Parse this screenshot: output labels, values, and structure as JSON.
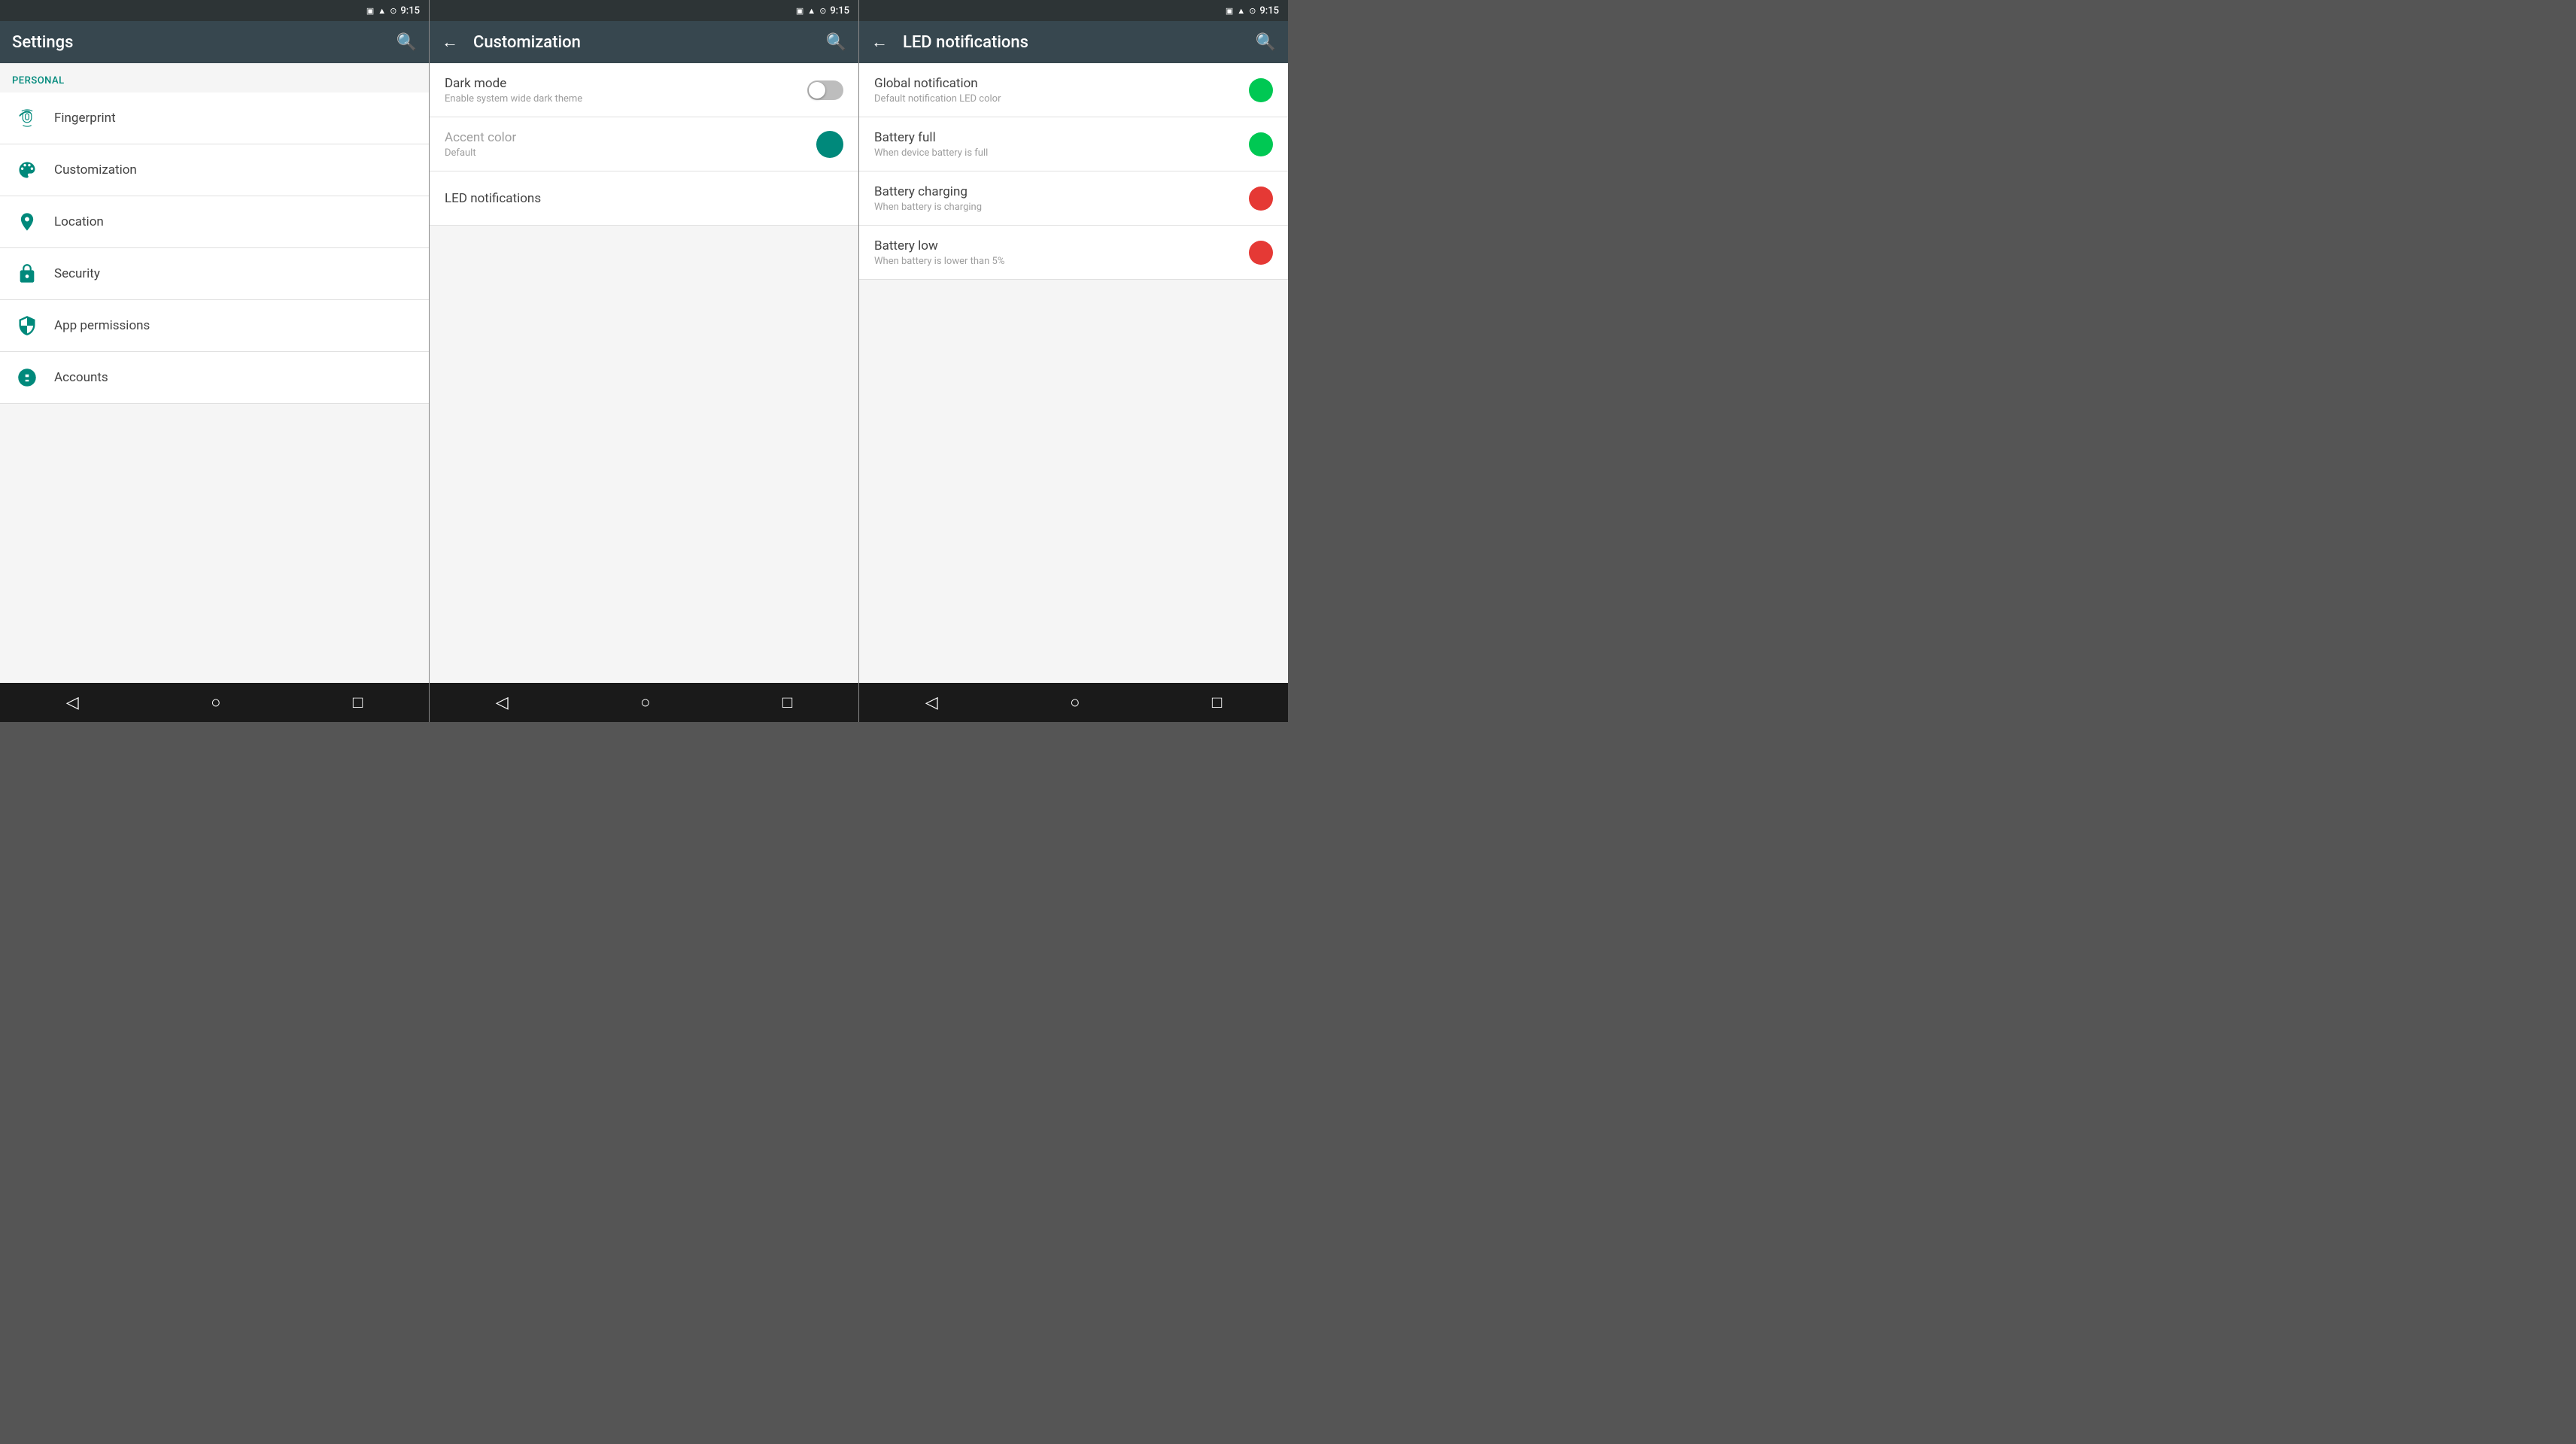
{
  "screens": [
    {
      "id": "settings",
      "statusBar": {
        "time": "9:15",
        "icons": [
          "vibrate",
          "signal",
          "battery"
        ]
      },
      "topBar": {
        "title": "Settings",
        "hasBack": false,
        "hasSearch": true
      },
      "sectionLabel": "Personal",
      "items": [
        {
          "id": "fingerprint",
          "label": "Fingerprint",
          "icon": "fingerprint"
        },
        {
          "id": "customization",
          "label": "Customization",
          "icon": "customization"
        },
        {
          "id": "location",
          "label": "Location",
          "icon": "location"
        },
        {
          "id": "security",
          "label": "Security",
          "icon": "security"
        },
        {
          "id": "app-permissions",
          "label": "App permissions",
          "icon": "shield"
        },
        {
          "id": "accounts",
          "label": "Accounts",
          "icon": "accounts"
        }
      ],
      "navBar": {
        "back": "◁",
        "home": "○",
        "recent": "□"
      }
    },
    {
      "id": "customization",
      "statusBar": {
        "time": "9:15"
      },
      "topBar": {
        "title": "Customization",
        "hasBack": true,
        "hasSearch": true
      },
      "settings": [
        {
          "id": "dark-mode",
          "title": "Dark mode",
          "subtitle": "Enable system wide dark theme",
          "type": "toggle",
          "enabled": false
        },
        {
          "id": "accent-color",
          "title": "Accent color",
          "subtitle": "Default",
          "type": "color",
          "color": "#00897b",
          "dimmed": true
        },
        {
          "id": "led-notifications",
          "title": "LED notifications",
          "type": "plain"
        }
      ],
      "navBar": {
        "back": "◁",
        "home": "○",
        "recent": "□"
      }
    },
    {
      "id": "led",
      "statusBar": {
        "time": "9:15"
      },
      "topBar": {
        "title": "LED notifications",
        "hasBack": true,
        "hasSearch": true
      },
      "ledItems": [
        {
          "id": "global",
          "title": "Global notification",
          "subtitle": "Default notification LED color",
          "color": "#00c853"
        },
        {
          "id": "battery-full",
          "title": "Battery full",
          "subtitle": "When device battery is full",
          "color": "#00c853"
        },
        {
          "id": "battery-charging",
          "title": "Battery charging",
          "subtitle": "When battery is charging",
          "color": "#e53935"
        },
        {
          "id": "battery-low",
          "title": "Battery low",
          "subtitle": "When battery is lower than 5%",
          "color": "#e53935"
        }
      ],
      "navBar": {
        "back": "◁",
        "home": "○",
        "recent": "□"
      }
    }
  ]
}
